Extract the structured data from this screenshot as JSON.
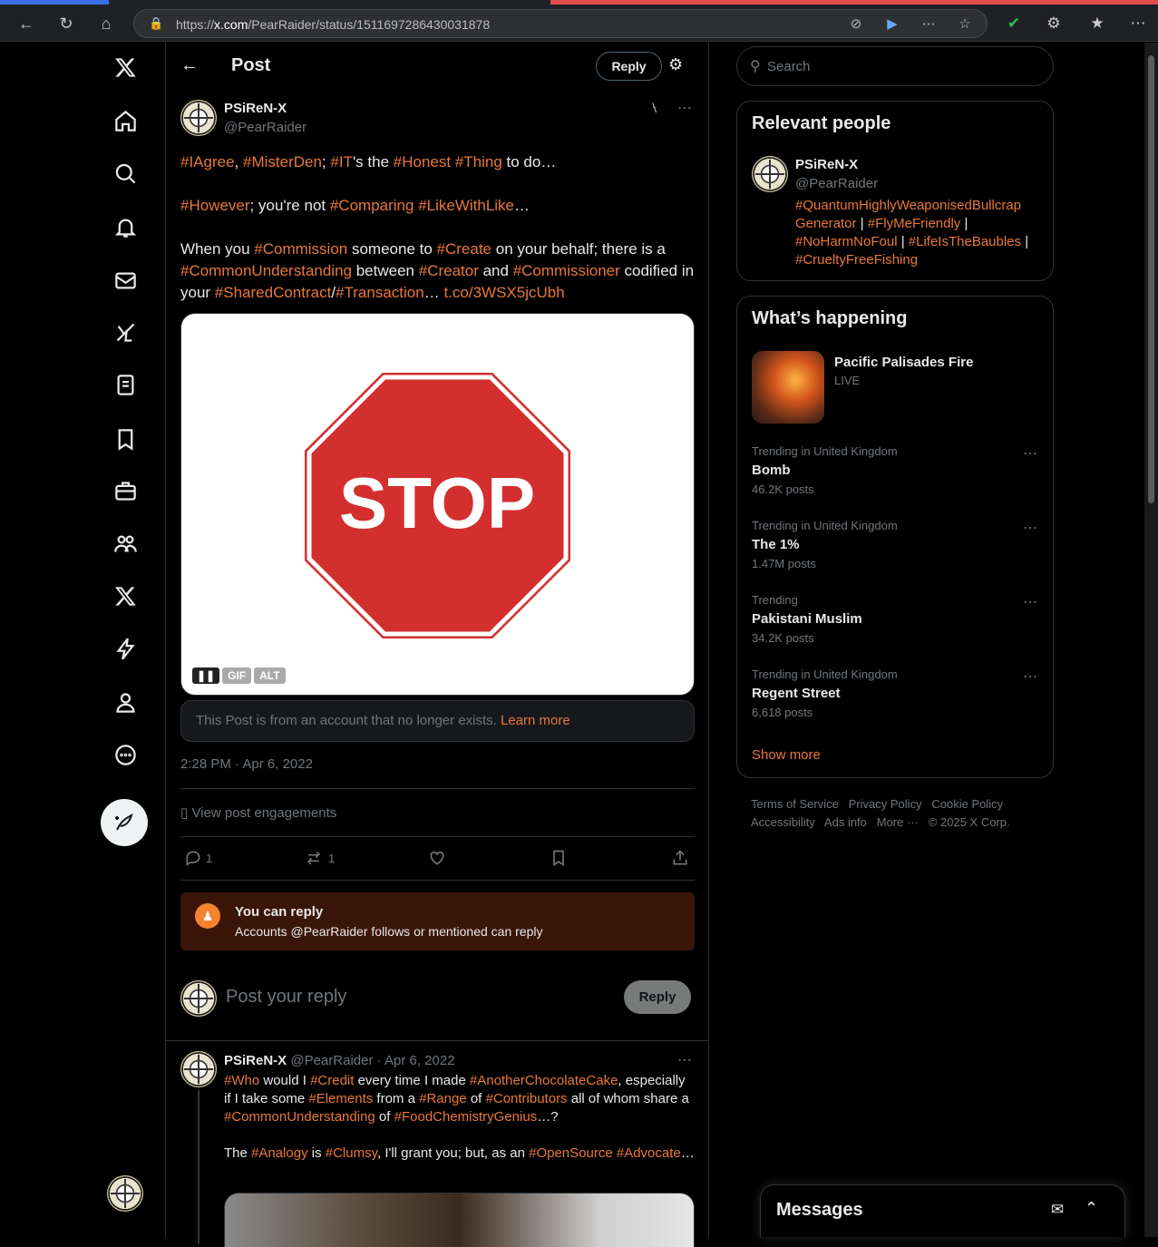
{
  "browser": {
    "url_prefix": "https://",
    "url_host": "x.com",
    "url_path": "/PearRaider/status/1511697286430031878"
  },
  "header": {
    "title": "Post",
    "reply_button": "Reply"
  },
  "post": {
    "display_name": "PSiReN-X",
    "handle": "@PearRaider",
    "line1": [
      [
        "#IAgree",
        "tag"
      ],
      [
        ", ",
        ""
      ],
      [
        "#MisterDen",
        "tag"
      ],
      [
        "; ",
        ""
      ],
      [
        "#IT",
        "tag"
      ],
      [
        "'s the ",
        ""
      ],
      [
        "#Honest",
        "tag"
      ],
      [
        " ",
        ""
      ],
      [
        "#Thing",
        "tag"
      ],
      [
        " to do…",
        ""
      ]
    ],
    "line2": [
      [
        "#However",
        "tag"
      ],
      [
        "; you're not ",
        ""
      ],
      [
        "#Comparing",
        "tag"
      ],
      [
        " ",
        ""
      ],
      [
        "#LikeWithLike",
        "tag"
      ],
      [
        "…",
        ""
      ]
    ],
    "line3": [
      [
        "When you ",
        ""
      ],
      [
        "#Commission",
        "tag"
      ],
      [
        " someone to  ",
        ""
      ],
      [
        "#Create",
        "tag"
      ],
      [
        " on your behalf; there is a ",
        ""
      ],
      [
        "#CommonUnderstanding",
        "tag"
      ],
      [
        " between  ",
        ""
      ],
      [
        "#Creator",
        "tag"
      ],
      [
        " and ",
        ""
      ],
      [
        "#Commissioner",
        "tag"
      ],
      [
        " codified in your ",
        ""
      ],
      [
        "#SharedContract",
        "tag"
      ],
      [
        "/",
        ""
      ],
      [
        "#Transaction",
        "tag"
      ],
      [
        "…  ",
        ""
      ],
      [
        "t.co/3WSX5jcUbh",
        "tag"
      ]
    ],
    "media_text": "STOP",
    "media_badges": {
      "gif": "GIF",
      "alt": "ALT"
    },
    "notice_text": "This Post is from an account that no longer exists.",
    "notice_link": "Learn more",
    "timestamp": "2:28 PM · Apr 6, 2022",
    "engagements": "View post engagements",
    "reply_count": "1",
    "repost_count": "1"
  },
  "reply_notice": {
    "title": "You can reply",
    "subtitle": "Accounts @PearRaider follows or mentioned can reply"
  },
  "composer": {
    "placeholder": "Post your reply",
    "button": "Reply"
  },
  "thread_reply": {
    "display_name": "PSiReN-X",
    "handle": "@PearRaider",
    "date": "Apr 6, 2022",
    "para1": [
      [
        "#Who",
        "tag"
      ],
      [
        " would  I ",
        ""
      ],
      [
        "#Credit",
        "tag"
      ],
      [
        " every time I made ",
        ""
      ],
      [
        "#AnotherChocolateCake",
        "tag"
      ],
      [
        ", especially if I take some ",
        ""
      ],
      [
        "#Elements",
        "tag"
      ],
      [
        " from a ",
        ""
      ],
      [
        "#Range",
        "tag"
      ],
      [
        " of ",
        ""
      ],
      [
        "#Contributors",
        "tag"
      ],
      [
        " all of whom share a ",
        ""
      ],
      [
        "#CommonUnderstanding",
        "tag"
      ],
      [
        " of ",
        ""
      ],
      [
        "#FoodChemistryGenius",
        "tag"
      ],
      [
        "…?",
        ""
      ]
    ],
    "para2": [
      [
        "The ",
        ""
      ],
      [
        "#Analogy",
        "tag"
      ],
      [
        " is ",
        ""
      ],
      [
        "#Clumsy",
        "tag"
      ],
      [
        ", I'll grant you; but, as an ",
        ""
      ],
      [
        "#OpenSource",
        "tag"
      ],
      [
        " ",
        ""
      ],
      [
        "#Advocate",
        "tag"
      ],
      [
        "…",
        ""
      ]
    ]
  },
  "search": {
    "placeholder": "Search"
  },
  "relevant_people": {
    "title": "Relevant people",
    "name": "PSiReN-X",
    "handle": "@PearRaider",
    "bio": [
      [
        "#QuantumHighlyWeaponisedBullcrap Generator",
        "tag"
      ],
      [
        " | ",
        ""
      ],
      [
        "#FlyMeFriendly",
        "tag"
      ],
      [
        " | ",
        ""
      ],
      [
        "#NoHarmNoFoul",
        "tag"
      ],
      [
        " | ",
        ""
      ],
      [
        "#LifeIsTheBaubles",
        "tag"
      ],
      [
        " | ",
        ""
      ],
      [
        "#CrueltyFreeFishing",
        "tag"
      ]
    ]
  },
  "happening": {
    "title": "What’s happening",
    "featured": {
      "title": "Pacific Palisades Fire",
      "status": "LIVE"
    },
    "trends": [
      {
        "context": "Trending in United Kingdom",
        "name": "Bomb",
        "posts": "46.2K posts"
      },
      {
        "context": "Trending in United Kingdom",
        "name": "The 1%",
        "posts": "1.47M posts"
      },
      {
        "context": "Trending",
        "name": "Pakistani Muslim",
        "posts": "34.2K posts"
      },
      {
        "context": "Trending in United Kingdom",
        "name": "Regent Street",
        "posts": "6,618 posts"
      }
    ],
    "show_more": "Show more"
  },
  "footer": {
    "terms": "Terms of Service",
    "privacy": "Privacy Policy",
    "cookie": "Cookie Policy",
    "accessibility": "Accessibility",
    "ads": "Ads info",
    "more": "More ···",
    "copyright": "© 2025 X Corp."
  },
  "messages": {
    "title": "Messages"
  }
}
